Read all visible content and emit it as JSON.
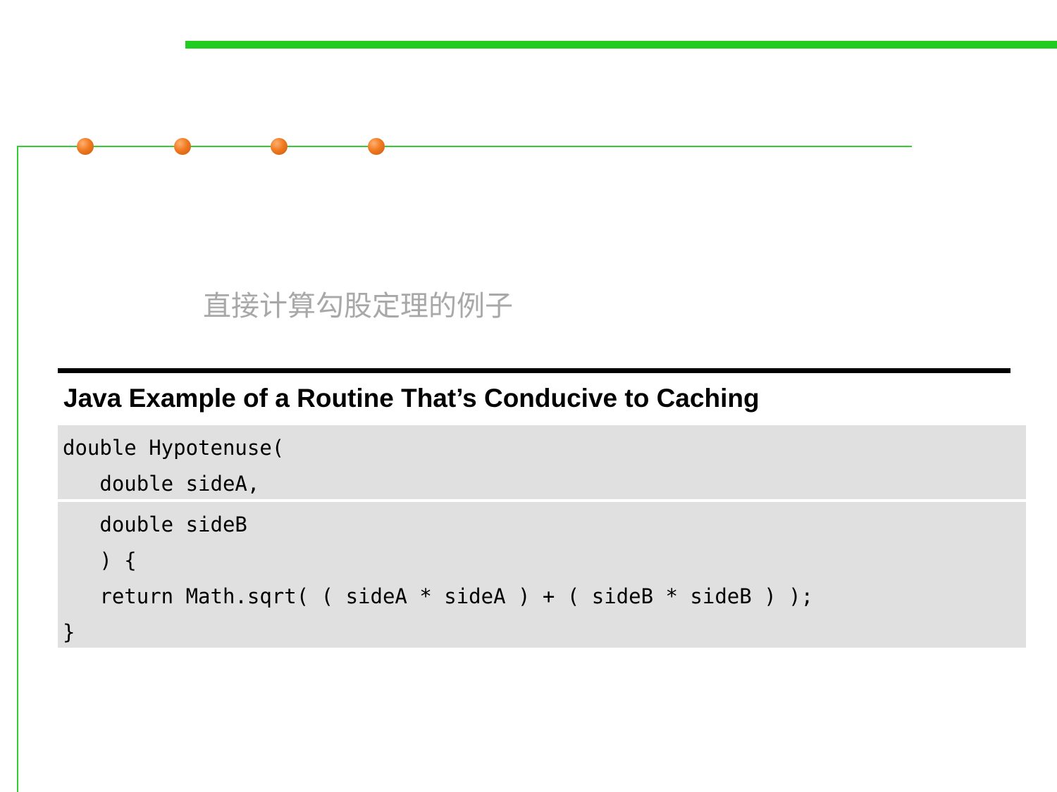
{
  "subtitle": "直接计算勾股定理的例子",
  "listing_title": "Java Example of a Routine That’s Conducive to Caching",
  "code_lines": [
    "double Hypotenuse(",
    "   double sideA,",
    "   double sideB",
    "   ) {",
    "   return Math.sqrt( ( sideA * sideA ) + ( sideB * sideB ) );",
    "}"
  ],
  "colors": {
    "accent_green": "#1fcc1f",
    "rule_green": "#33cc33",
    "dot_orange": "#f07a20",
    "code_background": "#e0e0e0",
    "subtitle_gray": "#a8a8a8"
  }
}
